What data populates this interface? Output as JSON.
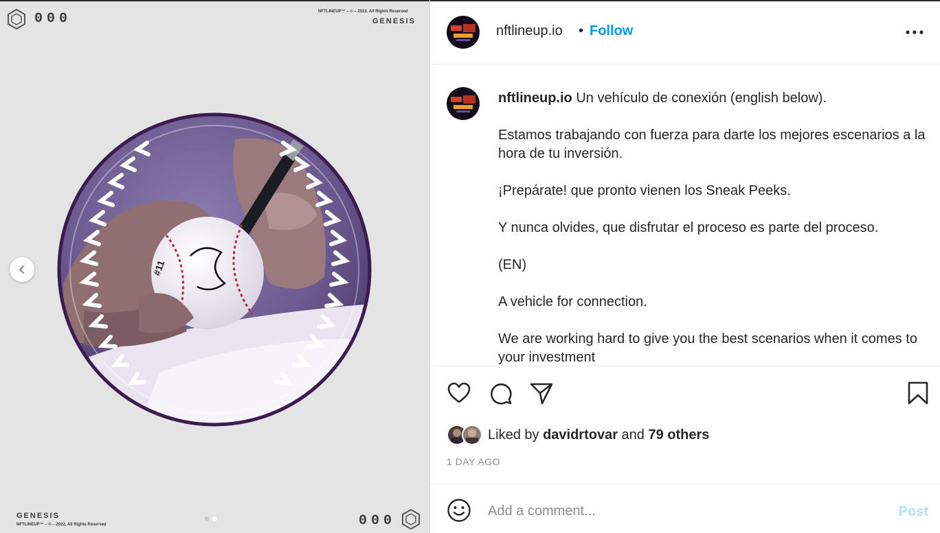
{
  "media": {
    "counter_top": "000",
    "counter_bottom": "000",
    "copyright_top": "NFTLINEUP™ – © – 2022. All Rights Reserved",
    "series_top": "GENESIS",
    "series_bottom": "GENESIS",
    "copyright_bottom": "NFTLINEUP™ – © – 2022. All Rights Reserved",
    "carousel": {
      "slides": 2,
      "active_slide": 2
    },
    "icons": {
      "prev": "chevron-left-icon",
      "logo": "hexagon-icon"
    },
    "colors": {
      "background": "#e4e4e4",
      "ring": "#3b1c4f",
      "photo_tint": "#7a6a9c"
    }
  },
  "post": {
    "header": {
      "username": "nftlineup.io",
      "separator": "•",
      "follow_label": "Follow",
      "more_icon": "more-horizontal-icon"
    },
    "caption": {
      "username": "nftlineup.io",
      "first_line": " Un vehículo de conexión (english below).",
      "paragraphs": [
        "Estamos trabajando con fuerza para darte los mejores escenarios a la hora de tu inversión.",
        "¡Prepárate! que pronto vienen los Sneak Peeks.",
        "Y nunca olvides, que disfrutar el proceso es parte del proceso.",
        "(EN)",
        "A vehicle for connection.",
        "We are working hard to give you the best scenarios when it comes to your investment"
      ]
    },
    "actions": {
      "icons": [
        "heart-icon",
        "comment-icon",
        "share-icon",
        "bookmark-icon"
      ]
    },
    "likes": {
      "prefix": "Liked by ",
      "user": "davidrtovar",
      "middle": " and ",
      "others": "79 others"
    },
    "time": "1 DAY AGO",
    "comment": {
      "placeholder": "Add a comment...",
      "post_label": "Post",
      "emoji_icon": "emoji-icon"
    },
    "colors": {
      "link": "#0095f6",
      "post_disabled": "#b2dffc",
      "muted": "#8e8e8e"
    }
  }
}
